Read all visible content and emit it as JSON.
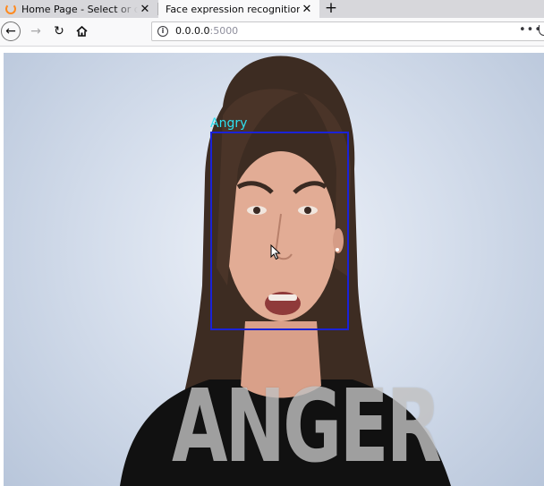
{
  "browser": {
    "tabs": [
      {
        "label": "Home Page - Select or create"
      },
      {
        "label": "Face expression recognition"
      }
    ],
    "url_host": "0.0.0.0",
    "url_port": ":5000"
  },
  "icons": {
    "tab_favicon": "loading-spinner-icon",
    "tab_close": "close-icon",
    "new_tab": "plus-icon",
    "back": "arrow-left-icon",
    "forward": "arrow-right-icon",
    "reload": "reload-icon",
    "home": "home-icon",
    "site_info": "info-icon",
    "page_actions": "more-icon",
    "pocket": "pocket-icon",
    "cursor": "mouse-pointer-icon"
  },
  "video": {
    "detected_emotion": "Angry",
    "overlay_text": "ANGER",
    "box_color": "#1a22d8",
    "label_color": "#2ee0f0"
  }
}
